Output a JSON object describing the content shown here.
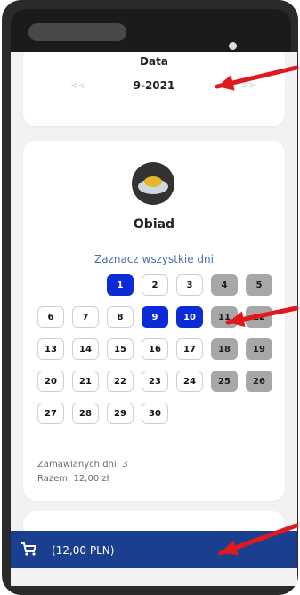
{
  "date": {
    "title": "Data",
    "prev": "<<",
    "value": "9-2021",
    "next": ">>"
  },
  "meal": {
    "title": "Obiad",
    "select_all": "Zaznacz wszystkie dni",
    "days": [
      {
        "label": "1",
        "state": "selected"
      },
      {
        "label": "2",
        "state": "normal"
      },
      {
        "label": "3",
        "state": "normal"
      },
      {
        "label": "4",
        "state": "disabled"
      },
      {
        "label": "5",
        "state": "disabled"
      },
      {
        "label": "6",
        "state": "normal"
      },
      {
        "label": "7",
        "state": "normal"
      },
      {
        "label": "8",
        "state": "normal"
      },
      {
        "label": "9",
        "state": "selected"
      },
      {
        "label": "10",
        "state": "selected"
      },
      {
        "label": "11",
        "state": "disabled"
      },
      {
        "label": "12",
        "state": "disabled"
      },
      {
        "label": "13",
        "state": "normal"
      },
      {
        "label": "14",
        "state": "normal"
      },
      {
        "label": "15",
        "state": "normal"
      },
      {
        "label": "16",
        "state": "normal"
      },
      {
        "label": "17",
        "state": "normal"
      },
      {
        "label": "18",
        "state": "disabled"
      },
      {
        "label": "19",
        "state": "disabled"
      },
      {
        "label": "20",
        "state": "normal"
      },
      {
        "label": "21",
        "state": "normal"
      },
      {
        "label": "22",
        "state": "normal"
      },
      {
        "label": "23",
        "state": "normal"
      },
      {
        "label": "24",
        "state": "normal"
      },
      {
        "label": "25",
        "state": "disabled"
      },
      {
        "label": "26",
        "state": "disabled"
      },
      {
        "label": "27",
        "state": "normal"
      },
      {
        "label": "28",
        "state": "normal"
      },
      {
        "label": "29",
        "state": "normal"
      },
      {
        "label": "30",
        "state": "normal"
      }
    ],
    "ordered_days": "Zamawianych dni: 3",
    "total": "Razem: 12,00 zł"
  },
  "cart": {
    "label": "(12,00 PLN)"
  },
  "colors": {
    "selected": "#0a2bd6",
    "disabled": "#a7a7a7",
    "link": "#4a6fb0",
    "cart_bar": "#1b3f8f",
    "annotation_arrow": "#e0191e"
  }
}
